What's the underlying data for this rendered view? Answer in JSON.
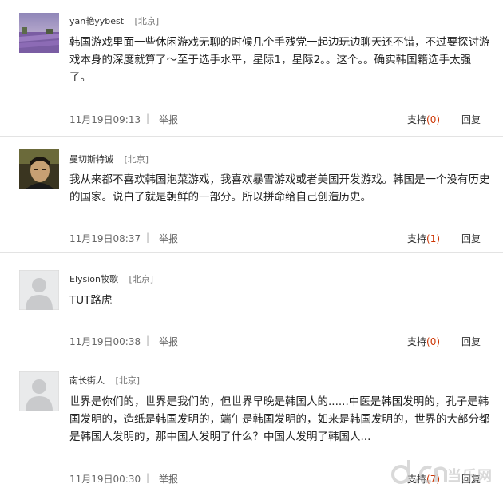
{
  "comments": [
    {
      "username": "yan艳yybest",
      "location": "[北京]",
      "text": "韩国游戏里面一些休闲游戏无聊的时候几个手残党一起边玩边聊天还不错，不过要探讨游戏本身的深度就算了～至于选手水平，星际1，星际2。。这个。。确实韩国籍选手太强了。",
      "time": "11月19日09:13",
      "separator": "|",
      "report": "举报",
      "support_label": "支持",
      "support_count": "(0)",
      "reply": "回复"
    },
    {
      "username": "曼切斯特诚",
      "location": "[北京]",
      "text": "我从来都不喜欢韩国泡菜游戏，我喜欢暴雪游戏或者美国开发游戏。韩国是一个没有历史的国家。说白了就是朝鲜的一部分。所以拼命给自己创造历史。",
      "time": "11月19日08:37",
      "separator": "|",
      "report": "举报",
      "support_label": "支持",
      "support_count": "(1)",
      "reply": "回复"
    },
    {
      "username": "Elysion牧歌",
      "location": "[北京]",
      "text": "TUT路虎",
      "time": "11月19日00:38",
      "separator": "|",
      "report": "举报",
      "support_label": "支持",
      "support_count": "(0)",
      "reply": "回复"
    },
    {
      "username": "南长街人",
      "location": "[北京]",
      "text": "世界是你们的，世界是我们的，但世界早晚是韩国人的......中医是韩国发明的，孔子是韩国发明的，造纸是韩国发明的，端午是韩国发明的，如来是韩国发明的，世界的大部分都是韩国人发明的，那中国人发明了什么？中国人发明了韩国人...",
      "time": "11月19日00:30",
      "separator": "|",
      "report": "举报",
      "support_label": "支持",
      "support_count": "(7)",
      "reply": "回复"
    }
  ],
  "watermark": {
    "text": "当乐网",
    "mark": "d.cn"
  }
}
